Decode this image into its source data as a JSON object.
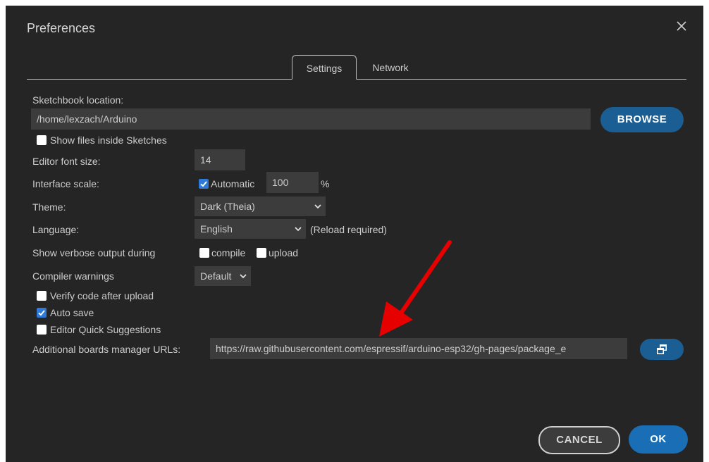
{
  "dialog": {
    "title": "Preferences"
  },
  "tabs": [
    {
      "label": "Settings"
    },
    {
      "label": "Network"
    }
  ],
  "sketchbook": {
    "label": "Sketchbook location:",
    "value": "/home/lexzach/Arduino",
    "browse_label": "BROWSE",
    "show_files_label": "Show files inside Sketches",
    "show_files_checked": false
  },
  "font_size": {
    "label": "Editor font size:",
    "value": "14"
  },
  "interface_scale": {
    "label": "Interface scale:",
    "automatic_label": "Automatic",
    "automatic_checked": true,
    "value": "100",
    "unit": "%"
  },
  "theme": {
    "label": "Theme:",
    "value": "Dark (Theia)"
  },
  "language": {
    "label": "Language:",
    "value": "English",
    "note": "(Reload required)"
  },
  "verbose": {
    "label": "Show verbose output during",
    "compile_label": "compile",
    "compile_checked": false,
    "upload_label": "upload",
    "upload_checked": false
  },
  "compiler_warnings": {
    "label": "Compiler warnings",
    "value": "Default"
  },
  "options": [
    {
      "label": "Verify code after upload",
      "checked": false
    },
    {
      "label": "Auto save",
      "checked": true
    },
    {
      "label": "Editor Quick Suggestions",
      "checked": false
    }
  ],
  "boards_urls": {
    "label": "Additional boards manager URLs:",
    "value": "https://raw.githubusercontent.com/espressif/arduino-esp32/gh-pages/package_e"
  },
  "footer": {
    "cancel_label": "CANCEL",
    "ok_label": "OK"
  },
  "colors": {
    "background": "#252526",
    "field": "#3c3c3c",
    "primary": "#1b5e94",
    "annotation_arrow": "#e60000"
  },
  "icons": {
    "close": "close-icon",
    "open_window": "open-window-icon",
    "chevron": "chevron-down-icon",
    "arrow": "red-annotation-arrow"
  }
}
